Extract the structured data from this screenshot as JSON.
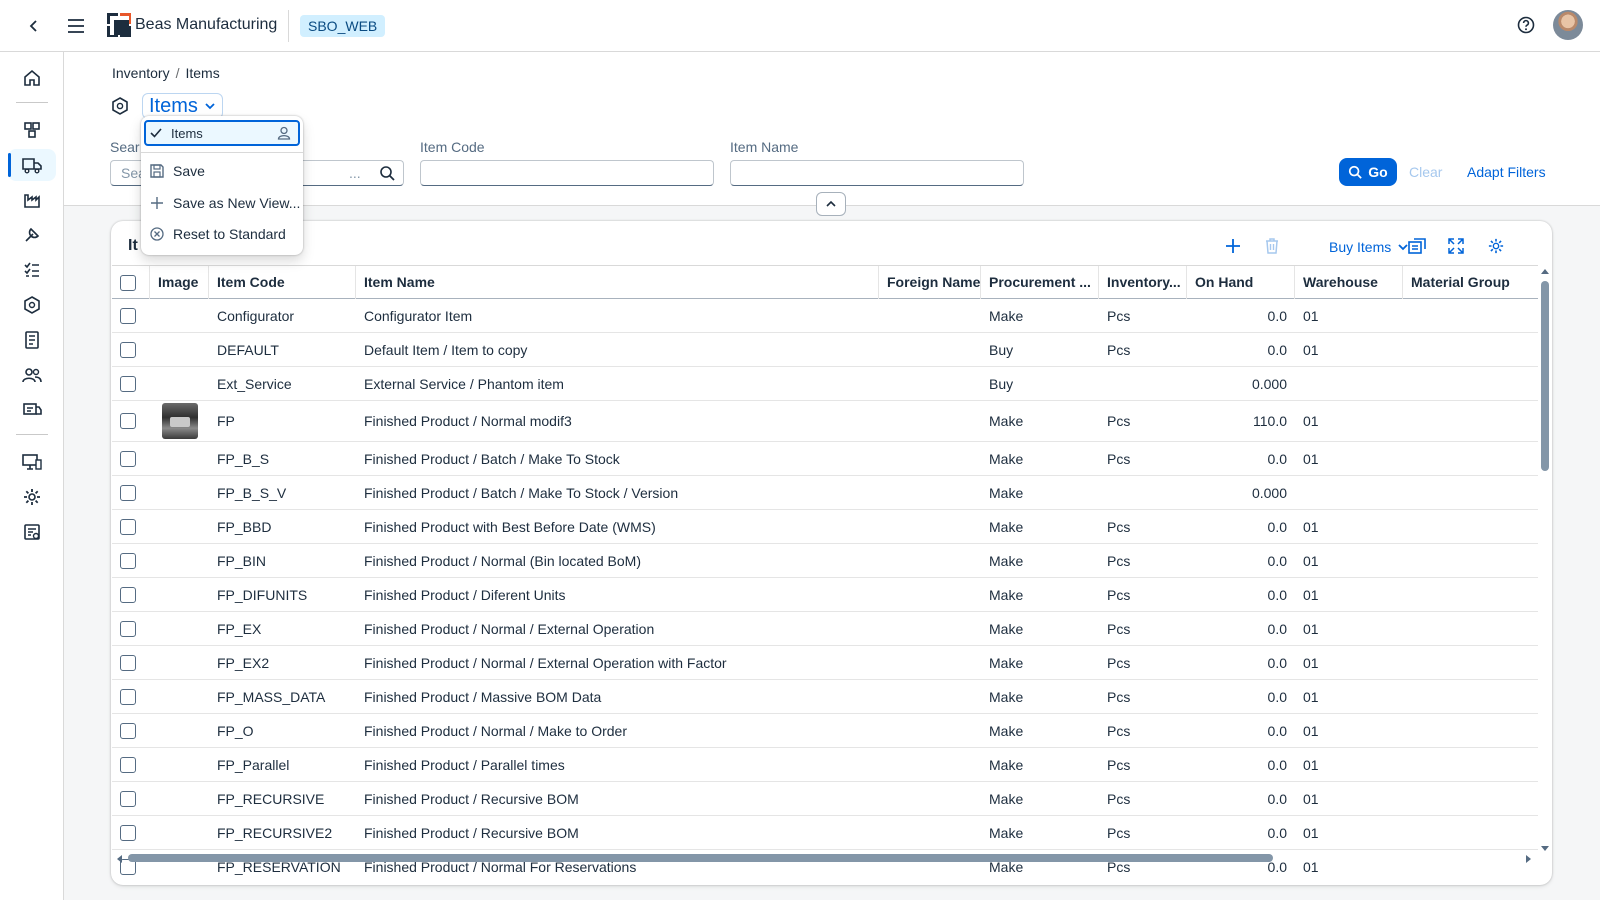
{
  "shell": {
    "brand": "Beas Manufacturing",
    "system": "SBO_WEB"
  },
  "breadcrumb": {
    "parent": "Inventory",
    "current": "Items"
  },
  "page": {
    "variant_title": "Items"
  },
  "filters": {
    "search_label": "Sear",
    "search_placeholder": "Sea",
    "search_suffix": "...",
    "item_code_label": "Item Code",
    "item_name_label": "Item Name",
    "go": "Go",
    "clear": "Clear",
    "adapt": "Adapt Filters"
  },
  "variant_menu": {
    "selected": "Items",
    "save": "Save",
    "save_as": "Save as New View...",
    "reset": "Reset to Standard"
  },
  "table": {
    "title": "It",
    "buy_items": "Buy Items",
    "columns": [
      "Image",
      "Item Code",
      "Item Name",
      "Foreign Name",
      "Procurement ...",
      "Inventory...",
      "On Hand",
      "Warehouse",
      "Material Group"
    ],
    "rows": [
      {
        "code": "Configurator",
        "name": "Configurator Item",
        "proc": "Make",
        "uom": "Pcs",
        "onhand": "0.0",
        "wh": "01",
        "img": false
      },
      {
        "code": "DEFAULT",
        "name": "Default Item / Item to copy",
        "proc": "Buy",
        "uom": "Pcs",
        "onhand": "0.0",
        "wh": "01",
        "img": false
      },
      {
        "code": "Ext_Service",
        "name": "External Service / Phantom item",
        "proc": "Buy",
        "uom": "",
        "onhand": "0.000",
        "wh": "",
        "img": false
      },
      {
        "code": "FP",
        "name": "Finished Product / Normal modif3",
        "proc": "Make",
        "uom": "Pcs",
        "onhand": "110.0",
        "wh": "01",
        "img": true
      },
      {
        "code": "FP_B_S",
        "name": "Finished Product / Batch / Make To Stock",
        "proc": "Make",
        "uom": "Pcs",
        "onhand": "0.0",
        "wh": "01",
        "img": false
      },
      {
        "code": "FP_B_S_V",
        "name": "Finished Product / Batch / Make To Stock / Version",
        "proc": "Make",
        "uom": "",
        "onhand": "0.000",
        "wh": "",
        "img": false
      },
      {
        "code": "FP_BBD",
        "name": "Finished Product with Best Before Date (WMS)",
        "proc": "Make",
        "uom": "Pcs",
        "onhand": "0.0",
        "wh": "01",
        "img": false
      },
      {
        "code": "FP_BIN",
        "name": "Finished Product / Normal (Bin located BoM)",
        "proc": "Make",
        "uom": "Pcs",
        "onhand": "0.0",
        "wh": "01",
        "img": false
      },
      {
        "code": "FP_DIFUNITS",
        "name": "Finished Product / Diferent Units",
        "proc": "Make",
        "uom": "Pcs",
        "onhand": "0.0",
        "wh": "01",
        "img": false
      },
      {
        "code": "FP_EX",
        "name": "Finished Product / Normal / External Operation",
        "proc": "Make",
        "uom": "Pcs",
        "onhand": "0.0",
        "wh": "01",
        "img": false
      },
      {
        "code": "FP_EX2",
        "name": "Finished Product / Normal / External Operation with Factor",
        "proc": "Make",
        "uom": "Pcs",
        "onhand": "0.0",
        "wh": "01",
        "img": false
      },
      {
        "code": "FP_MASS_DATA",
        "name": "Finished Product / Massive BOM Data",
        "proc": "Make",
        "uom": "Pcs",
        "onhand": "0.0",
        "wh": "01",
        "img": false
      },
      {
        "code": "FP_O",
        "name": "Finished Product / Normal / Make to Order",
        "proc": "Make",
        "uom": "Pcs",
        "onhand": "0.0",
        "wh": "01",
        "img": false
      },
      {
        "code": "FP_Parallel",
        "name": "Finished Product / Parallel times",
        "proc": "Make",
        "uom": "Pcs",
        "onhand": "0.0",
        "wh": "01",
        "img": false
      },
      {
        "code": "FP_RECURSIVE",
        "name": "Finished Product / Recursive BOM",
        "proc": "Make",
        "uom": "Pcs",
        "onhand": "0.0",
        "wh": "01",
        "img": false
      },
      {
        "code": "FP_RECURSIVE2",
        "name": "Finished Product / Recursive BOM",
        "proc": "Make",
        "uom": "Pcs",
        "onhand": "0.0",
        "wh": "01",
        "img": false
      },
      {
        "code": "FP_RESERVATION",
        "name": "Finished Product / Normal For Reservations",
        "proc": "Make",
        "uom": "Pcs",
        "onhand": "0.0",
        "wh": "01",
        "img": false
      }
    ]
  },
  "colors": {
    "accent": "#0064d9",
    "shell_bg": "#ffffff",
    "page_bg": "#f5f6f7",
    "system_badge": "#d1efff"
  },
  "icons": [
    "back-icon",
    "menu-icon",
    "help-icon",
    "home-icon",
    "add-icon",
    "delete-icon",
    "export-icon",
    "fullscreen-icon",
    "settings-icon",
    "search-icon",
    "check-icon",
    "person-icon",
    "save-icon",
    "plus-icon",
    "reset-icon"
  ]
}
